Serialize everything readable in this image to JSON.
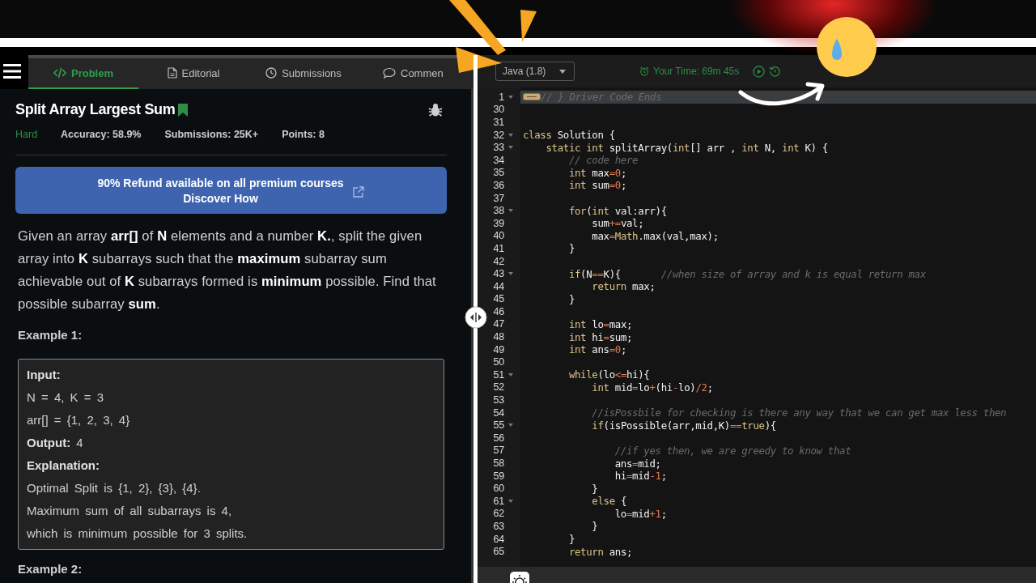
{
  "tabs": [
    {
      "label": "Problem",
      "selected": true
    },
    {
      "label": "Editorial",
      "selected": false
    },
    {
      "label": "Submissions",
      "selected": false
    },
    {
      "label": "Commen",
      "selected": false
    }
  ],
  "problem": {
    "title": "Split Array Largest Sum",
    "bookmarked": true,
    "difficulty": "Hard",
    "meta": [
      "Accuracy: 58.9%",
      "Submissions: 25K+",
      "Points: 8"
    ],
    "banner": [
      "90% Refund available on all premium courses",
      "Discover How"
    ],
    "description": "Given an array **arr[]** of **N** elements and a number **K.**, split the given array into **K** subarrays such that the **maximum** subarray sum achievable out of **K** subarrays formed is **minimum** possible. Find that possible subarray **sum**.",
    "example_heading": "Example 1:",
    "example_lines": [
      {
        "kind": "label",
        "text": "Input:"
      },
      {
        "kind": "text",
        "text": "N = 4, K = 3"
      },
      {
        "kind": "text",
        "text": "arr[] = {1, 2, 3, 4}"
      },
      {
        "kind": "labelled",
        "label": "Output:",
        "text": "4"
      },
      {
        "kind": "label",
        "text": "Explanation:"
      },
      {
        "kind": "text",
        "text": "Optimal Split is {1, 2}, {3}, {4}."
      },
      {
        "kind": "text",
        "text": "Maximum sum of all subarrays is 4,"
      },
      {
        "kind": "text",
        "text": "which is minimum possible for 3 splits."
      }
    ],
    "next_heading": "Example 2:"
  },
  "editor": {
    "language": "Java (1.8)",
    "timer": "Your Time: 69m 45s",
    "lines": [
      {
        "number": "1",
        "fold": true,
        "highlighted": true,
        "segments": [
          {
            "kind": "comment",
            "text": "// } Driver Code Ends"
          }
        ]
      },
      {
        "number": "30",
        "fold": false,
        "highlighted": false
      },
      {
        "number": "31",
        "fold": false,
        "highlighted": false
      },
      {
        "number": "32",
        "fold": true,
        "highlighted": false,
        "segments": [
          {
            "kind": "keyword",
            "text": "class"
          },
          {
            "kind": "plain",
            "text": " Solution {"
          }
        ]
      },
      {
        "number": "33",
        "fold": true,
        "highlighted": false,
        "segments": [
          {
            "kind": "keyword",
            "text": "    static int"
          },
          {
            "kind": "plain",
            "text": " splitArray("
          },
          {
            "kind": "keyword",
            "text": "int"
          },
          {
            "kind": "plain",
            "text": "[] arr , "
          },
          {
            "kind": "keyword",
            "text": "int"
          },
          {
            "kind": "plain",
            "text": " N, "
          },
          {
            "kind": "keyword",
            "text": "int"
          },
          {
            "kind": "plain",
            "text": " K) {"
          }
        ]
      },
      {
        "number": "34",
        "fold": false,
        "highlighted": false,
        "segments": [
          {
            "kind": "comment",
            "text": "        // code here"
          }
        ]
      },
      {
        "number": "35",
        "fold": false,
        "highlighted": false,
        "segments": [
          {
            "kind": "keyword",
            "text": "        int"
          },
          {
            "kind": "plain",
            "text": " max"
          },
          {
            "kind": "operator",
            "text": "=0"
          },
          {
            "kind": "plain",
            "text": ";"
          }
        ]
      },
      {
        "number": "36",
        "fold": false,
        "highlighted": false,
        "segments": [
          {
            "kind": "keyword",
            "text": "        int"
          },
          {
            "kind": "plain",
            "text": " sum"
          },
          {
            "kind": "operator",
            "text": "=0"
          },
          {
            "kind": "plain",
            "text": ";"
          }
        ]
      },
      {
        "number": "37",
        "fold": false,
        "highlighted": false
      },
      {
        "number": "38",
        "fold": true,
        "highlighted": false,
        "segments": [
          {
            "kind": "keyword",
            "text": "        for"
          },
          {
            "kind": "plain",
            "text": "("
          },
          {
            "kind": "keyword",
            "text": "int"
          },
          {
            "kind": "plain",
            "text": " val:arr){"
          }
        ]
      },
      {
        "number": "39",
        "fold": false,
        "highlighted": false,
        "segments": [
          {
            "kind": "plain",
            "text": "            sum"
          },
          {
            "kind": "operator",
            "text": "+="
          },
          {
            "kind": "plain",
            "text": "val;"
          }
        ]
      },
      {
        "number": "40",
        "fold": false,
        "highlighted": false,
        "segments": [
          {
            "kind": "plain",
            "text": "            max"
          },
          {
            "kind": "operator",
            "text": "="
          },
          {
            "kind": "keyword",
            "text": "Math"
          },
          {
            "kind": "plain",
            "text": ".max(val,max);"
          }
        ]
      },
      {
        "number": "41",
        "fold": false,
        "highlighted": false,
        "segments": [
          {
            "kind": "plain",
            "text": "        }"
          }
        ]
      },
      {
        "number": "42",
        "fold": false,
        "highlighted": false
      },
      {
        "number": "43",
        "fold": true,
        "highlighted": false,
        "segments": [
          {
            "kind": "keyword",
            "text": "        if"
          },
          {
            "kind": "plain",
            "text": "(N"
          },
          {
            "kind": "operator",
            "text": "=="
          },
          {
            "kind": "plain",
            "text": "K){       "
          },
          {
            "kind": "comment",
            "text": "//when size of array and k is equal return max"
          }
        ]
      },
      {
        "number": "44",
        "fold": false,
        "highlighted": false,
        "segments": [
          {
            "kind": "keyword",
            "text": "            return"
          },
          {
            "kind": "plain",
            "text": " max;"
          }
        ]
      },
      {
        "number": "45",
        "fold": false,
        "highlighted": false,
        "segments": [
          {
            "kind": "plain",
            "text": "        }"
          }
        ]
      },
      {
        "number": "46",
        "fold": false,
        "highlighted": false
      },
      {
        "number": "47",
        "fold": false,
        "highlighted": false,
        "segments": [
          {
            "kind": "keyword",
            "text": "        int"
          },
          {
            "kind": "plain",
            "text": " lo"
          },
          {
            "kind": "operator",
            "text": "="
          },
          {
            "kind": "plain",
            "text": "max;"
          }
        ]
      },
      {
        "number": "48",
        "fold": false,
        "highlighted": false,
        "segments": [
          {
            "kind": "keyword",
            "text": "        int"
          },
          {
            "kind": "plain",
            "text": " hi"
          },
          {
            "kind": "operator",
            "text": "="
          },
          {
            "kind": "plain",
            "text": "sum;"
          }
        ]
      },
      {
        "number": "49",
        "fold": false,
        "highlighted": false,
        "segments": [
          {
            "kind": "keyword",
            "text": "        int"
          },
          {
            "kind": "plain",
            "text": " ans"
          },
          {
            "kind": "operator",
            "text": "=0"
          },
          {
            "kind": "plain",
            "text": ";"
          }
        ]
      },
      {
        "number": "50",
        "fold": false,
        "highlighted": false
      },
      {
        "number": "51",
        "fold": true,
        "highlighted": false,
        "segments": [
          {
            "kind": "keyword",
            "text": "        while"
          },
          {
            "kind": "plain",
            "text": "(lo"
          },
          {
            "kind": "operator",
            "text": "<="
          },
          {
            "kind": "plain",
            "text": "hi){"
          }
        ]
      },
      {
        "number": "52",
        "fold": false,
        "highlighted": false,
        "segments": [
          {
            "kind": "keyword",
            "text": "            int"
          },
          {
            "kind": "plain",
            "text": " mid"
          },
          {
            "kind": "operator",
            "text": "="
          },
          {
            "kind": "plain",
            "text": "lo"
          },
          {
            "kind": "operator",
            "text": "+"
          },
          {
            "kind": "plain",
            "text": "(hi"
          },
          {
            "kind": "operator",
            "text": "-"
          },
          {
            "kind": "plain",
            "text": "lo)"
          },
          {
            "kind": "operator",
            "text": "/2"
          },
          {
            "kind": "plain",
            "text": ";"
          }
        ]
      },
      {
        "number": "53",
        "fold": false,
        "highlighted": false
      },
      {
        "number": "54",
        "fold": false,
        "highlighted": false,
        "segments": [
          {
            "kind": "comment",
            "text": "            //isPossbile for checking is there any way that we can get max less then"
          }
        ]
      },
      {
        "number": "55",
        "fold": true,
        "highlighted": false,
        "segments": [
          {
            "kind": "keyword",
            "text": "            if"
          },
          {
            "kind": "plain",
            "text": "(isPossible(arr,mid,K)"
          },
          {
            "kind": "operator",
            "text": "=="
          },
          {
            "kind": "keyword",
            "text": "true"
          },
          {
            "kind": "plain",
            "text": "){"
          }
        ]
      },
      {
        "number": "56",
        "fold": false,
        "highlighted": false
      },
      {
        "number": "57",
        "fold": false,
        "highlighted": false,
        "segments": [
          {
            "kind": "comment",
            "text": "                //if yes then, we are greedy to know that"
          }
        ]
      },
      {
        "number": "58",
        "fold": false,
        "highlighted": false,
        "segments": [
          {
            "kind": "plain",
            "text": "                ans"
          },
          {
            "kind": "operator",
            "text": "="
          },
          {
            "kind": "plain",
            "text": "mid;"
          }
        ]
      },
      {
        "number": "59",
        "fold": false,
        "highlighted": false,
        "segments": [
          {
            "kind": "plain",
            "text": "                hi"
          },
          {
            "kind": "operator",
            "text": "="
          },
          {
            "kind": "plain",
            "text": "mid"
          },
          {
            "kind": "operator",
            "text": "-1"
          },
          {
            "kind": "plain",
            "text": ";"
          }
        ]
      },
      {
        "number": "60",
        "fold": false,
        "highlighted": false,
        "segments": [
          {
            "kind": "plain",
            "text": "            }"
          }
        ]
      },
      {
        "number": "61",
        "fold": true,
        "highlighted": false,
        "segments": [
          {
            "kind": "keyword",
            "text": "            else"
          },
          {
            "kind": "plain",
            "text": " {"
          }
        ]
      },
      {
        "number": "62",
        "fold": false,
        "highlighted": false,
        "segments": [
          {
            "kind": "plain",
            "text": "                lo"
          },
          {
            "kind": "operator",
            "text": "="
          },
          {
            "kind": "plain",
            "text": "mid"
          },
          {
            "kind": "operator",
            "text": "+1"
          },
          {
            "kind": "plain",
            "text": ";"
          }
        ]
      },
      {
        "number": "63",
        "fold": false,
        "highlighted": false,
        "segments": [
          {
            "kind": "plain",
            "text": "            }"
          }
        ]
      },
      {
        "number": "64",
        "fold": false,
        "highlighted": false,
        "segments": [
          {
            "kind": "plain",
            "text": "        }"
          }
        ]
      },
      {
        "number": "65",
        "fold": false,
        "highlighted": false,
        "segments": [
          {
            "kind": "keyword",
            "text": "        return"
          },
          {
            "kind": "plain",
            "text": " ans;"
          }
        ]
      }
    ]
  }
}
